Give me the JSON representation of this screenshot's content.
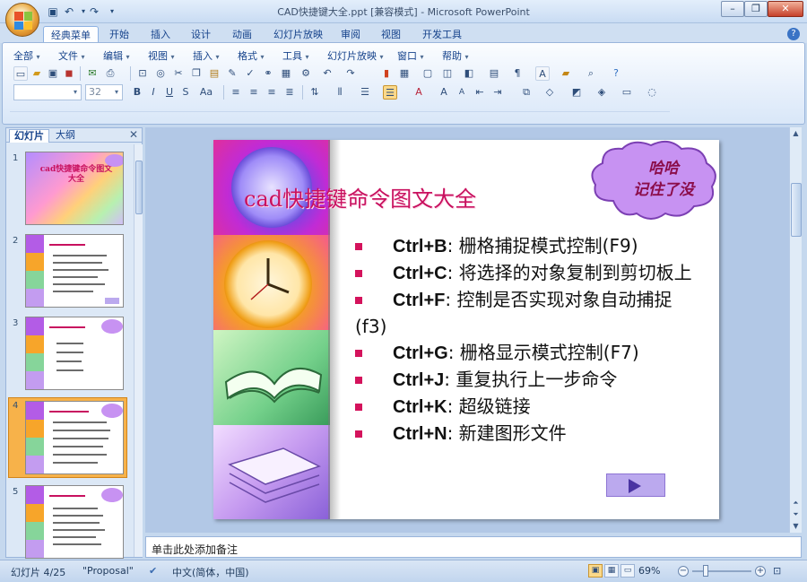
{
  "window": {
    "title": "CAD快捷键大全.ppt [兼容模式] - Microsoft PowerPoint",
    "minimize": "–",
    "restore": "❐",
    "close": "✕"
  },
  "ribbon_tabs": [
    "经典菜单",
    "开始",
    "插入",
    "设计",
    "动画",
    "幻灯片放映",
    "审阅",
    "视图",
    "开发工具"
  ],
  "menu": [
    "全部",
    "文件",
    "编辑",
    "视图",
    "插入",
    "格式",
    "工具",
    "幻灯片放映",
    "窗口",
    "帮助"
  ],
  "font_box": {
    "name": "",
    "size": "32"
  },
  "left_pane": {
    "tabs": [
      "幻灯片",
      "大纲"
    ],
    "close": "✕",
    "slide_numbers": [
      "1",
      "2",
      "3",
      "4",
      "5"
    ],
    "slide1_title": "cad快捷键命令图文大全"
  },
  "slide": {
    "title": "cad快捷键命令图文大全",
    "callout": [
      "哈哈",
      "记住了没"
    ],
    "bullets": [
      {
        "key": "Ctrl+B",
        "text": ": 栅格捕捉模式控制(F9)"
      },
      {
        "key": "Ctrl+C",
        "text": ": 将选择的对象复制到剪切板上"
      },
      {
        "key": "Ctrl+F",
        "text": ": 控制是否实现对象自动捕捉(f3)"
      },
      {
        "key": "Ctrl+G",
        "text": ": 栅格显示模式控制(F7)"
      },
      {
        "key": "Ctrl+J",
        "text": ": 重复执行上一步命令"
      },
      {
        "key": "Ctrl+K",
        "text": ": 超级链接"
      },
      {
        "key": "Ctrl+N",
        "text": ": 新建图形文件"
      }
    ]
  },
  "notes": {
    "placeholder": "单击此处添加备注"
  },
  "status": {
    "slide": "幻灯片 4/25",
    "theme": "\"Proposal\"",
    "language": "中文(简体，中国)",
    "zoom": "69%",
    "zoom_level_fraction": 0.69
  },
  "colors": {
    "title": "#c8115f",
    "bullet_marker": "#d4135c",
    "callout_fill": "#c792f2",
    "callout_border": "#7b3fb3"
  }
}
